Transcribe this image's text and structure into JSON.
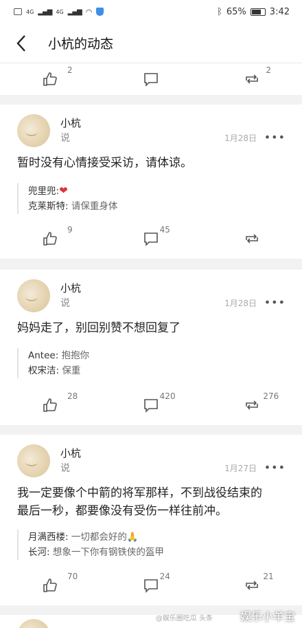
{
  "status": {
    "battery": "65%",
    "time": "3:42",
    "net1": "4G",
    "net2": "4G"
  },
  "nav": {
    "title": "小杭的动态"
  },
  "top_actions": {
    "like": "2",
    "comment": "",
    "repost": "2"
  },
  "posts": [
    {
      "author": "小杭",
      "verb": "说",
      "date": "1月28日",
      "content": "暂时没有心情接受采访，请体谅。",
      "comments": [
        {
          "user": "兜里兜:",
          "text": "",
          "heart": "❤"
        },
        {
          "user": "克莱斯特:",
          "text": " 请保重身体",
          "heart": ""
        }
      ],
      "likes": "9",
      "comments_count": "45",
      "reposts": ""
    },
    {
      "author": "小杭",
      "verb": "说",
      "date": "1月28日",
      "content": "妈妈走了，别回别赞不想回复了",
      "comments": [
        {
          "user": "Antee:",
          "text": " 抱抱你"
        },
        {
          "user": "权宋洁:",
          "text": " 保重"
        }
      ],
      "likes": "28",
      "comments_count": "420",
      "reposts": "276"
    },
    {
      "author": "小杭",
      "verb": "说",
      "date": "1月27日",
      "content_line1": "我一定要像个中箭的将军那样，不到战役结束的",
      "content_line2": "最后一秒，都要像没有受伤一样往前冲。",
      "comments": [
        {
          "user": "月满西楼:",
          "text": " 一切都会好的🙏"
        },
        {
          "user": "长河:",
          "text": " 想象一下你有钢铁侠的盔甲"
        }
      ],
      "likes": "70",
      "comments_count": "24",
      "reposts": "21"
    }
  ],
  "watermark": {
    "main": "娱乐小羊宝",
    "sub": "@娱乐圈吃瓜 头条"
  }
}
